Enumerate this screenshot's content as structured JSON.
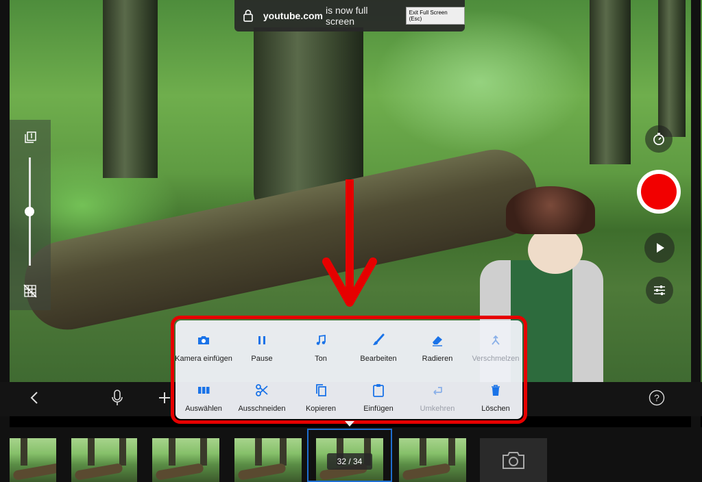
{
  "browser": {
    "fullscreen_site": "youtube.com",
    "fullscreen_message": "is now full screen",
    "exit_label": "Exit Full Screen (Esc)"
  },
  "left_panel": {
    "top_icon": "layers-1-icon",
    "bottom_icon": "grid-off-icon",
    "slider_level": 0.5
  },
  "right_controls": {
    "timer_icon": "timer-icon",
    "record_color": "#f20000",
    "play_icon": "play-icon",
    "settings_icon": "sliders-icon"
  },
  "annotation": {
    "arrow_color": "#e60000",
    "highlight_color": "#e60000"
  },
  "toolbar": {
    "back_icon": "chevron-left-icon",
    "mic_icon": "microphone-icon",
    "add_icon": "plus-icon",
    "help_icon": "question-circle-icon"
  },
  "context_menu": {
    "row1": [
      {
        "label": "Kamera einfügen",
        "icon": "camera-icon",
        "enabled": true
      },
      {
        "label": "Pause",
        "icon": "pause-icon",
        "enabled": true
      },
      {
        "label": "Ton",
        "icon": "music-note-icon",
        "enabled": true
      },
      {
        "label": "Bearbeiten",
        "icon": "brush-icon",
        "enabled": true
      },
      {
        "label": "Radieren",
        "icon": "eraser-icon",
        "enabled": true
      },
      {
        "label": "Verschmelzen",
        "icon": "merge-icon",
        "enabled": false
      }
    ],
    "row2": [
      {
        "label": "Auswählen",
        "icon": "select-frames-icon",
        "enabled": true
      },
      {
        "label": "Ausschneiden",
        "icon": "scissors-icon",
        "enabled": true
      },
      {
        "label": "Kopieren",
        "icon": "copy-icon",
        "enabled": true
      },
      {
        "label": "Einfügen",
        "icon": "clipboard-icon",
        "enabled": true
      },
      {
        "label": "Umkehren",
        "icon": "reverse-icon",
        "enabled": false
      },
      {
        "label": "Löschen",
        "icon": "trash-icon",
        "enabled": true
      }
    ]
  },
  "timeline": {
    "frame_counter": "32 / 34",
    "camera_icon": "camera-icon",
    "accent": "#1f6fd1"
  }
}
